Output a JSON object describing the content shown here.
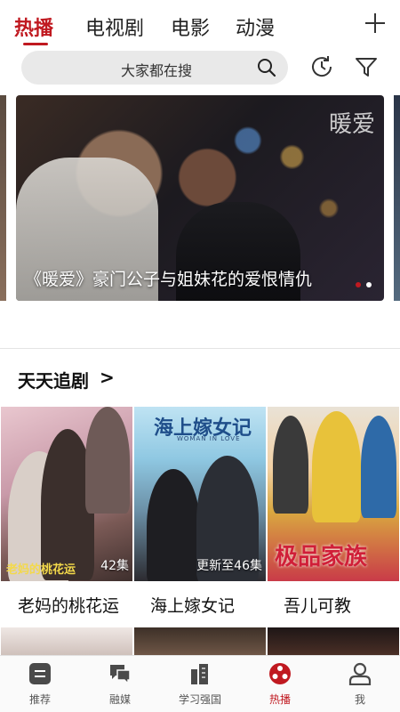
{
  "top_tabs": [
    {
      "label": "热播",
      "active": true
    },
    {
      "label": "电视剧",
      "active": false
    },
    {
      "label": "电影",
      "active": false
    },
    {
      "label": "动漫",
      "active": false
    }
  ],
  "search": {
    "placeholder": "大家都在搜"
  },
  "banner": {
    "logo_text": "暖爱",
    "caption": "《暖爱》豪门公子与姐妹花的爱恨情仇",
    "active_dot_color": "#c01920",
    "dot_color": "#ffffff"
  },
  "section": {
    "title": "天天追剧",
    "arrow": ">"
  },
  "dramas": [
    {
      "title": "老妈的桃花运",
      "count": "42集",
      "poster_art": "老妈的桃花运"
    },
    {
      "title": "海上嫁女记",
      "count": "更新至46集",
      "poster_art": "海上嫁女记",
      "poster_subtitle": "WOMAN IN LOVE"
    },
    {
      "title": "吾儿可教",
      "count": "",
      "poster_art": "极品家族"
    }
  ],
  "bottom_nav": [
    {
      "label": "推荐",
      "icon": "list-icon",
      "active": false
    },
    {
      "label": "融媒",
      "icon": "chat-icon",
      "active": false
    },
    {
      "label": "学习强国",
      "icon": "building-icon",
      "active": false
    },
    {
      "label": "热播",
      "icon": "film-reel-icon",
      "active": true
    },
    {
      "label": "我",
      "icon": "person-icon",
      "active": false
    }
  ],
  "colors": {
    "accent": "#c01920",
    "text": "#222222",
    "muted": "#555555"
  }
}
